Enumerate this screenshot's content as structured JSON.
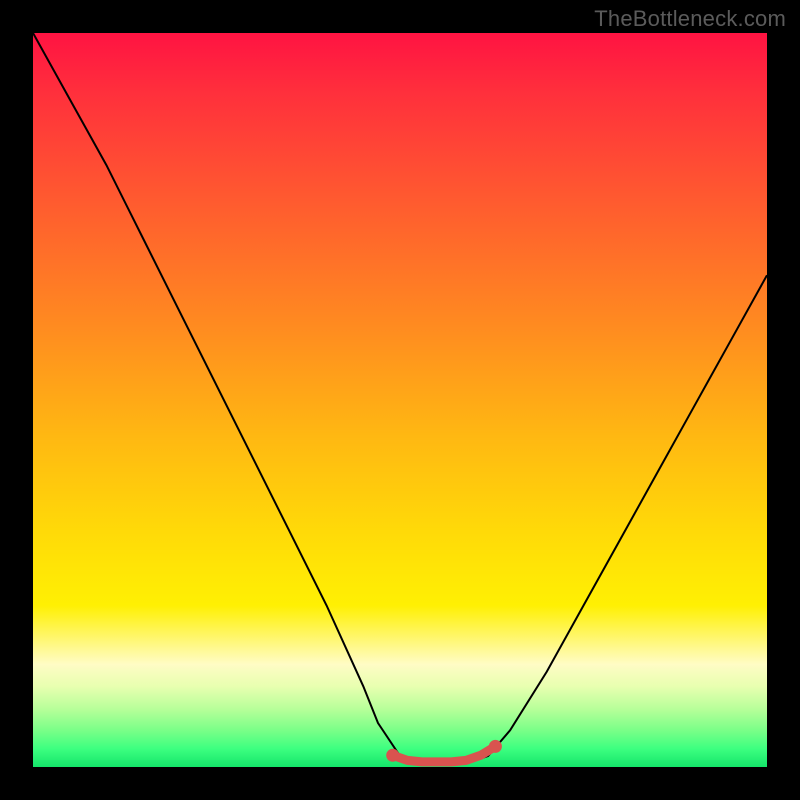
{
  "watermark": {
    "text": "TheBottleneck.com"
  },
  "colors": {
    "frame": "#000000",
    "curve": "#000000",
    "marker": "#d9534f",
    "marker_fill": "#d9534f"
  },
  "chart_data": {
    "type": "line",
    "title": "",
    "xlabel": "",
    "ylabel": "",
    "xlim": [
      0,
      100
    ],
    "ylim": [
      0,
      100
    ],
    "grid": false,
    "legend": false,
    "note": "background is a vertical gradient from red (high y) to green (low y); curve is a V-shape; values estimated from pixel positions",
    "series": [
      {
        "name": "bottleneck-curve",
        "x": [
          0,
          5,
          10,
          15,
          20,
          25,
          30,
          35,
          40,
          45,
          47,
          50,
          53,
          56,
          59,
          62,
          65,
          70,
          75,
          80,
          85,
          90,
          95,
          100
        ],
        "y": [
          100,
          91,
          82,
          72,
          62,
          52,
          42,
          32,
          22,
          11,
          6,
          1.5,
          0.5,
          0.5,
          0.5,
          1.5,
          5,
          13,
          22,
          31,
          40,
          49,
          58,
          67
        ]
      },
      {
        "name": "optimal-range-marker",
        "x": [
          49,
          51,
          53,
          55,
          57,
          59,
          61,
          63
        ],
        "y": [
          1.6,
          0.9,
          0.7,
          0.7,
          0.7,
          0.9,
          1.6,
          2.8
        ]
      }
    ]
  }
}
